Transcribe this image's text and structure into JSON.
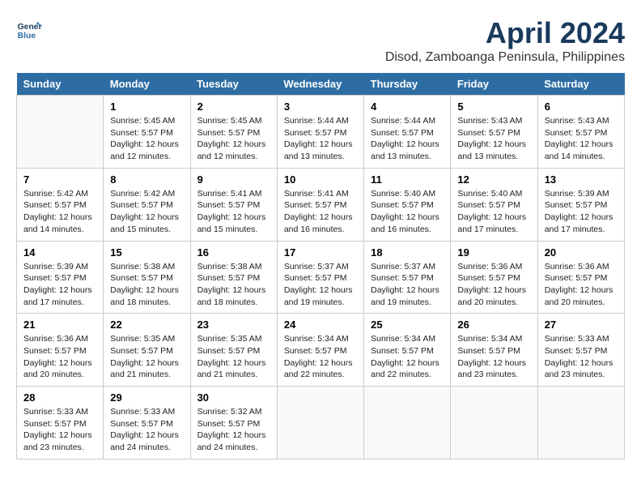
{
  "header": {
    "logo_line1": "General",
    "logo_line2": "Blue",
    "month": "April 2024",
    "location": "Disod, Zamboanga Peninsula, Philippines"
  },
  "weekdays": [
    "Sunday",
    "Monday",
    "Tuesday",
    "Wednesday",
    "Thursday",
    "Friday",
    "Saturday"
  ],
  "weeks": [
    [
      {
        "day": "",
        "info": ""
      },
      {
        "day": "1",
        "info": "Sunrise: 5:45 AM\nSunset: 5:57 PM\nDaylight: 12 hours\nand 12 minutes."
      },
      {
        "day": "2",
        "info": "Sunrise: 5:45 AM\nSunset: 5:57 PM\nDaylight: 12 hours\nand 12 minutes."
      },
      {
        "day": "3",
        "info": "Sunrise: 5:44 AM\nSunset: 5:57 PM\nDaylight: 12 hours\nand 13 minutes."
      },
      {
        "day": "4",
        "info": "Sunrise: 5:44 AM\nSunset: 5:57 PM\nDaylight: 12 hours\nand 13 minutes."
      },
      {
        "day": "5",
        "info": "Sunrise: 5:43 AM\nSunset: 5:57 PM\nDaylight: 12 hours\nand 13 minutes."
      },
      {
        "day": "6",
        "info": "Sunrise: 5:43 AM\nSunset: 5:57 PM\nDaylight: 12 hours\nand 14 minutes."
      }
    ],
    [
      {
        "day": "7",
        "info": "Sunrise: 5:42 AM\nSunset: 5:57 PM\nDaylight: 12 hours\nand 14 minutes."
      },
      {
        "day": "8",
        "info": "Sunrise: 5:42 AM\nSunset: 5:57 PM\nDaylight: 12 hours\nand 15 minutes."
      },
      {
        "day": "9",
        "info": "Sunrise: 5:41 AM\nSunset: 5:57 PM\nDaylight: 12 hours\nand 15 minutes."
      },
      {
        "day": "10",
        "info": "Sunrise: 5:41 AM\nSunset: 5:57 PM\nDaylight: 12 hours\nand 16 minutes."
      },
      {
        "day": "11",
        "info": "Sunrise: 5:40 AM\nSunset: 5:57 PM\nDaylight: 12 hours\nand 16 minutes."
      },
      {
        "day": "12",
        "info": "Sunrise: 5:40 AM\nSunset: 5:57 PM\nDaylight: 12 hours\nand 17 minutes."
      },
      {
        "day": "13",
        "info": "Sunrise: 5:39 AM\nSunset: 5:57 PM\nDaylight: 12 hours\nand 17 minutes."
      }
    ],
    [
      {
        "day": "14",
        "info": "Sunrise: 5:39 AM\nSunset: 5:57 PM\nDaylight: 12 hours\nand 17 minutes."
      },
      {
        "day": "15",
        "info": "Sunrise: 5:38 AM\nSunset: 5:57 PM\nDaylight: 12 hours\nand 18 minutes."
      },
      {
        "day": "16",
        "info": "Sunrise: 5:38 AM\nSunset: 5:57 PM\nDaylight: 12 hours\nand 18 minutes."
      },
      {
        "day": "17",
        "info": "Sunrise: 5:37 AM\nSunset: 5:57 PM\nDaylight: 12 hours\nand 19 minutes."
      },
      {
        "day": "18",
        "info": "Sunrise: 5:37 AM\nSunset: 5:57 PM\nDaylight: 12 hours\nand 19 minutes."
      },
      {
        "day": "19",
        "info": "Sunrise: 5:36 AM\nSunset: 5:57 PM\nDaylight: 12 hours\nand 20 minutes."
      },
      {
        "day": "20",
        "info": "Sunrise: 5:36 AM\nSunset: 5:57 PM\nDaylight: 12 hours\nand 20 minutes."
      }
    ],
    [
      {
        "day": "21",
        "info": "Sunrise: 5:36 AM\nSunset: 5:57 PM\nDaylight: 12 hours\nand 20 minutes."
      },
      {
        "day": "22",
        "info": "Sunrise: 5:35 AM\nSunset: 5:57 PM\nDaylight: 12 hours\nand 21 minutes."
      },
      {
        "day": "23",
        "info": "Sunrise: 5:35 AM\nSunset: 5:57 PM\nDaylight: 12 hours\nand 21 minutes."
      },
      {
        "day": "24",
        "info": "Sunrise: 5:34 AM\nSunset: 5:57 PM\nDaylight: 12 hours\nand 22 minutes."
      },
      {
        "day": "25",
        "info": "Sunrise: 5:34 AM\nSunset: 5:57 PM\nDaylight: 12 hours\nand 22 minutes."
      },
      {
        "day": "26",
        "info": "Sunrise: 5:34 AM\nSunset: 5:57 PM\nDaylight: 12 hours\nand 23 minutes."
      },
      {
        "day": "27",
        "info": "Sunrise: 5:33 AM\nSunset: 5:57 PM\nDaylight: 12 hours\nand 23 minutes."
      }
    ],
    [
      {
        "day": "28",
        "info": "Sunrise: 5:33 AM\nSunset: 5:57 PM\nDaylight: 12 hours\nand 23 minutes."
      },
      {
        "day": "29",
        "info": "Sunrise: 5:33 AM\nSunset: 5:57 PM\nDaylight: 12 hours\nand 24 minutes."
      },
      {
        "day": "30",
        "info": "Sunrise: 5:32 AM\nSunset: 5:57 PM\nDaylight: 12 hours\nand 24 minutes."
      },
      {
        "day": "",
        "info": ""
      },
      {
        "day": "",
        "info": ""
      },
      {
        "day": "",
        "info": ""
      },
      {
        "day": "",
        "info": ""
      }
    ]
  ]
}
